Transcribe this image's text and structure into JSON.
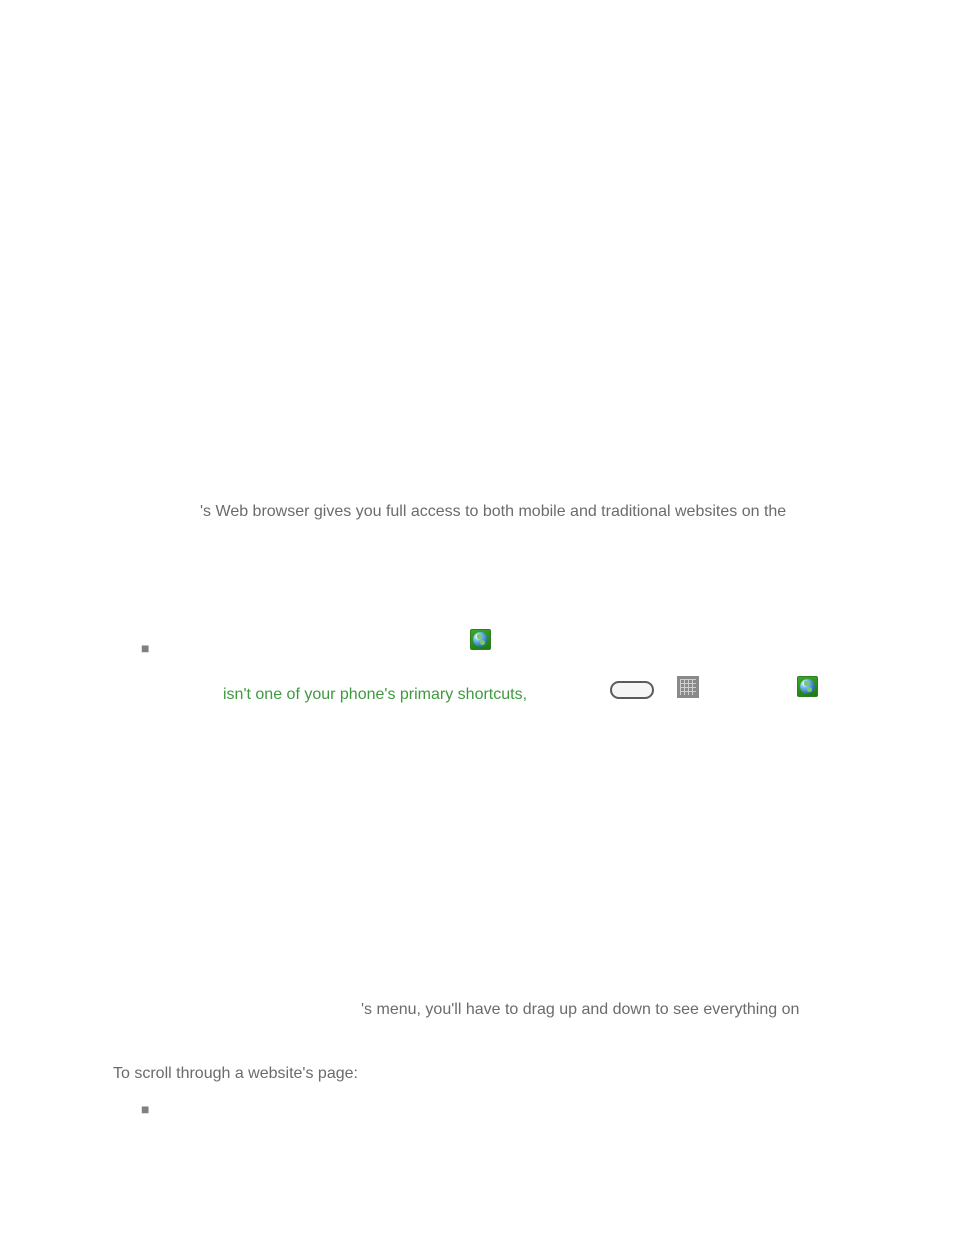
{
  "body": {
    "para1_line1_suffix": "'s Web browser gives you full access to both mobile and traditional websites on the",
    "bullet1_tip_middle": " isn't one of your phone's primary shortcuts,",
    "para2_line1_suffix": "'s menu, you'll have to drag up and down to see everything on",
    "scroll_heading": "To scroll through a website's page:"
  }
}
